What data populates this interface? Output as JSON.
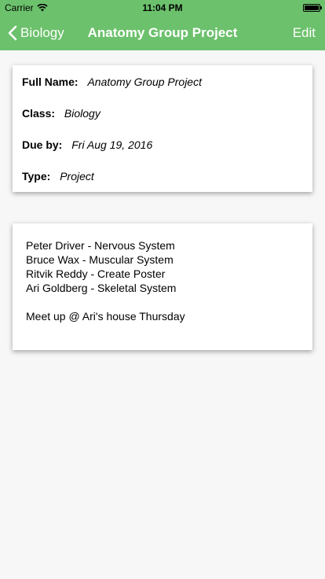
{
  "status_bar": {
    "carrier": "Carrier",
    "time": "11:04 PM",
    "wifi_icon": "wifi-icon",
    "battery_icon": "battery-icon"
  },
  "nav": {
    "back_label": "Biology",
    "back_icon": "chevron-left-icon",
    "title": "Anatomy Group Project",
    "edit_label": "Edit",
    "color": "#6cc16c"
  },
  "details": {
    "full_name_label": "Full Name:",
    "full_name_value": "Anatomy Group Project",
    "class_label": "Class:",
    "class_value": "Biology",
    "due_label": "Due by:",
    "due_value": "Fri Aug 19, 2016",
    "type_label": "Type:",
    "type_value": "Project"
  },
  "notes": {
    "lines": [
      "Peter Driver - Nervous System",
      "Bruce Wax - Muscular System",
      "Ritvik Reddy - Create Poster",
      "Ari Goldberg - Skeletal System"
    ],
    "footer": "Meet up @ Ari's house Thursday"
  }
}
